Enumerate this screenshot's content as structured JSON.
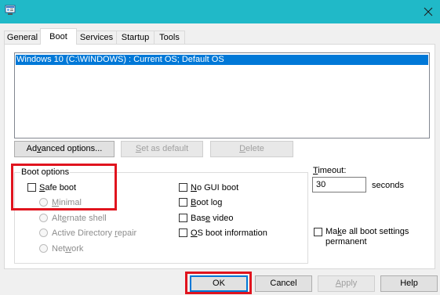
{
  "window": {
    "title_icon": "app-icon",
    "close_icon": "close-icon",
    "titlebar_color": "#20b9c8"
  },
  "tabs": [
    {
      "label": "General",
      "active": false
    },
    {
      "label": "Boot",
      "active": true
    },
    {
      "label": "Services",
      "active": false
    },
    {
      "label": "Startup",
      "active": false
    },
    {
      "label": "Tools",
      "active": false
    }
  ],
  "os_list": {
    "items": [
      "Windows 10 (C:\\WINDOWS) : Current OS; Default OS"
    ],
    "selected_color": "#0078d7"
  },
  "buttons": {
    "advanced_pre": "Ad",
    "advanced_u": "v",
    "advanced_post": "anced options...",
    "set_default_pre": "",
    "set_default_u": "S",
    "set_default_post": "et as default",
    "delete_pre": "",
    "delete_u": "D",
    "delete_post": "elete"
  },
  "boot_options": {
    "title": "Boot options",
    "safe_boot_pre": "",
    "safe_boot_u": "S",
    "safe_boot_post": "afe boot",
    "safe_boot_checked": false,
    "radios": [
      {
        "pre": "",
        "u": "M",
        "post": "inimal",
        "enabled": false
      },
      {
        "pre": "Alt",
        "u": "e",
        "post": "rnate shell",
        "enabled": false
      },
      {
        "pre": "Active Directory ",
        "u": "r",
        "post": "epair",
        "enabled": false
      },
      {
        "pre": "Net",
        "u": "w",
        "post": "ork",
        "enabled": false
      }
    ],
    "right_checks": [
      {
        "pre": "",
        "u": "N",
        "post": "o GUI boot",
        "checked": false
      },
      {
        "pre": "",
        "u": "B",
        "post": "oot log",
        "checked": false
      },
      {
        "pre": "Bas",
        "u": "e",
        "post": " video",
        "checked": false
      },
      {
        "pre": "",
        "u": "O",
        "post": "S boot information",
        "checked": false
      }
    ]
  },
  "timeout": {
    "label_pre": "",
    "label_u": "T",
    "label_post": "imeout:",
    "value": "30",
    "unit": "seconds"
  },
  "make_permanent": {
    "line1_pre": "Ma",
    "line1_u": "k",
    "line1_post": "e all boot settings",
    "line2": "permanent",
    "checked": false
  },
  "footer": {
    "ok": "OK",
    "cancel": "Cancel",
    "apply_pre": "",
    "apply_u": "A",
    "apply_post": "pply",
    "help": "Help"
  },
  "annotations": {
    "highlight_color": "#e0141e"
  }
}
